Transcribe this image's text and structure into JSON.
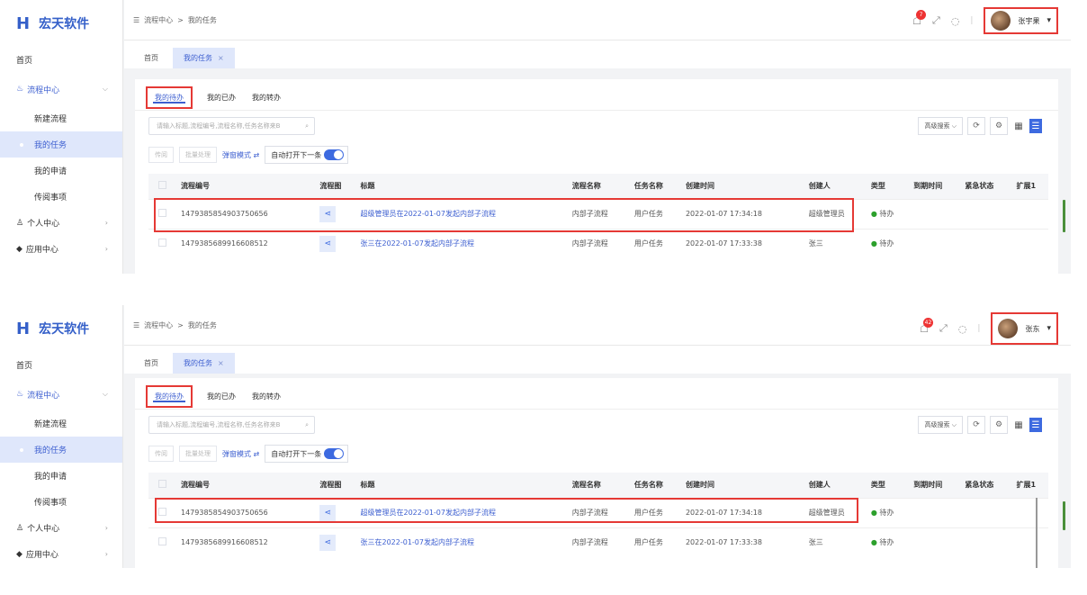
{
  "brand": {
    "name": "宏天软件"
  },
  "breadcrumb": [
    "流程中心",
    "我的任务"
  ],
  "sidebar": {
    "home": "首页",
    "flow_center": "流程中心",
    "sub_items": [
      "新建流程",
      "我的任务",
      "我的申请",
      "传阅事项"
    ],
    "personal": "个人中心",
    "apps": "应用中心"
  },
  "tabs": {
    "home": "首页",
    "current": "我的任务"
  },
  "subtabs": [
    "我的待办",
    "我的已办",
    "我的转办"
  ],
  "search": {
    "placeholder": "请输入标题,流程编号,流程名称,任务名称来B"
  },
  "toolbar": {
    "adv": "高级搜索",
    "transfer": "传阅",
    "batch": "批量处理",
    "popup": "弹窗模式",
    "auto_open": "自动打开下一条"
  },
  "table": {
    "headers": [
      "流程编号",
      "流程图",
      "标题",
      "流程名称",
      "任务名称",
      "创建时间",
      "创建人",
      "类型",
      "到期时间",
      "紧急状态",
      "扩展1"
    ],
    "rows": [
      {
        "id": "1479385854903750656",
        "title": "超级管理员在2022-01-07发起内部子流程",
        "flow": "内部子流程",
        "task": "用户任务",
        "time": "2022-01-07 17:34:18",
        "creator": "超级管理员",
        "type": "待办"
      },
      {
        "id": "1479385689916608512",
        "title": "张三在2022-01-07发起内部子流程",
        "flow": "内部子流程",
        "task": "用户任务",
        "time": "2022-01-07 17:33:38",
        "creator": "张三",
        "type": "待办"
      }
    ]
  },
  "frames": [
    {
      "user": "张宇果",
      "badge": "7"
    },
    {
      "user": "张东",
      "badge": "42"
    }
  ],
  "colors": {
    "accent": "#3d5fd0",
    "highlight": "#e53935",
    "status_green": "#2ca02c"
  }
}
